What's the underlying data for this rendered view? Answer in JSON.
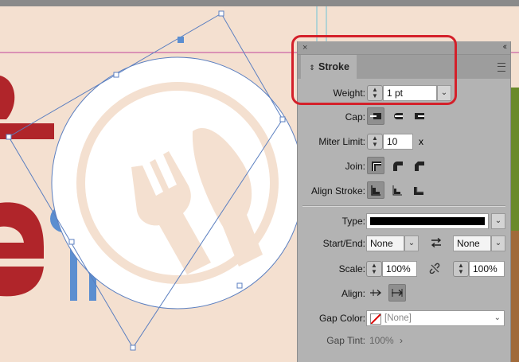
{
  "panel": {
    "tab_label": "Stroke",
    "close_glyph": "×",
    "collapse_glyph": "‹‹",
    "weight": {
      "label": "Weight:",
      "value": "1 pt"
    },
    "cap": {
      "label": "Cap:"
    },
    "miter": {
      "label": "Miter Limit:",
      "value": "10",
      "suffix": "x"
    },
    "join": {
      "label": "Join:"
    },
    "align_stroke": {
      "label": "Align Stroke:"
    },
    "type": {
      "label": "Type:"
    },
    "start_end": {
      "label": "Start/End:",
      "start": "None",
      "end": "None"
    },
    "scale": {
      "label": "Scale:",
      "start": "100%",
      "end": "100%"
    },
    "align": {
      "label": "Align:"
    },
    "gap_color": {
      "label": "Gap Color:",
      "value": "[None]"
    },
    "gap_tint": {
      "label": "Gap Tint:",
      "value": "100%"
    }
  },
  "colors": {
    "accent_red": "#d4202a",
    "canvas": "#f4e0d0",
    "panel": "#b3b3b3",
    "logo_blue": "#5b8ed0",
    "text_red": "#b0252a"
  },
  "icons": [
    "close-icon",
    "collapse-icon",
    "panel-menu-icon",
    "spinner-icon",
    "chevron-down-icon",
    "cap-butt-icon",
    "cap-round-icon",
    "cap-projecting-icon",
    "join-miter-icon",
    "join-round-icon",
    "join-bevel-icon",
    "align-center-icon",
    "align-inside-icon",
    "align-outside-icon",
    "swap-arrows-icon",
    "link-icon",
    "arrow-extend-icon",
    "arrow-align-icon",
    "none-swatch-icon"
  ]
}
